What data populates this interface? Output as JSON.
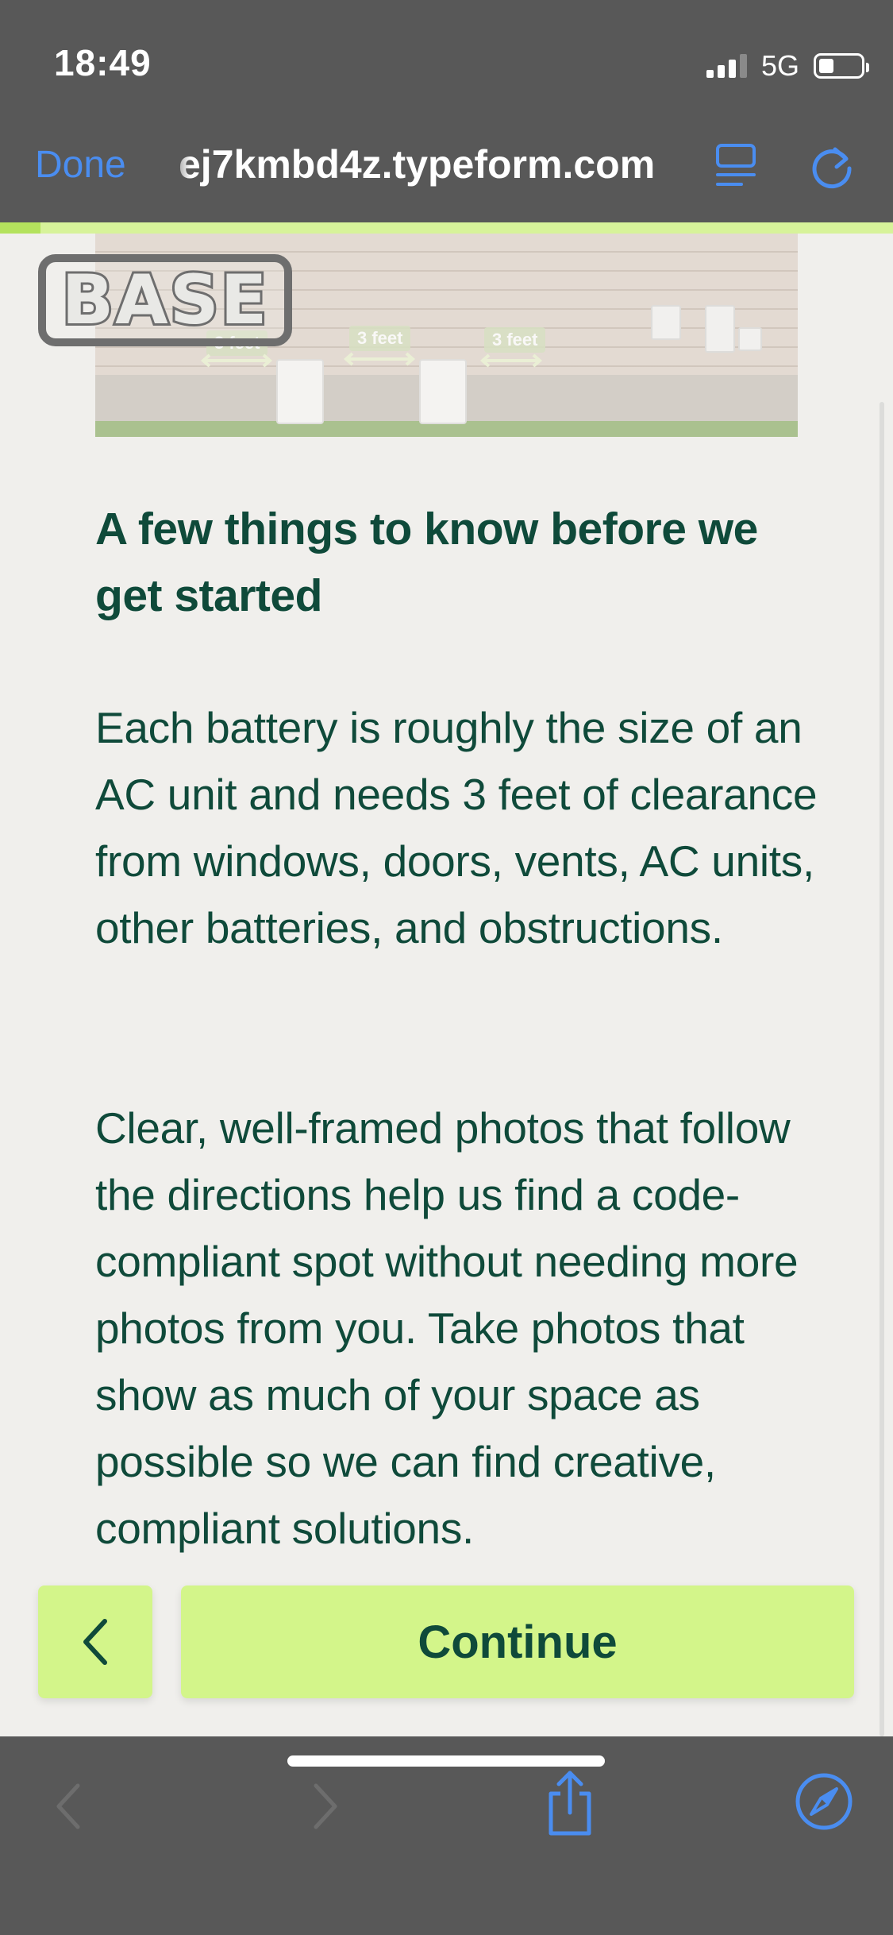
{
  "status_bar": {
    "time": "18:49",
    "network": "5G",
    "battery_level": 0.35
  },
  "browser": {
    "done_label": "Done",
    "url": "ej7kmbd4z.typeform.com",
    "accent_color": "#4a8df0"
  },
  "progress": {
    "fraction": 0.045
  },
  "hero": {
    "brand": "BASE",
    "clearance_labels": [
      "3 feet",
      "3 feet",
      "3 feet"
    ]
  },
  "content": {
    "heading": "A few things to know before we get started",
    "paragraph_1": "Each battery is roughly the size of an AC unit and needs 3 feet of clearance from windows, doors, vents, AC units, other batteries, and obstructions.",
    "paragraph_2": "Clear, well-framed photos that follow the directions help us find a code-compliant spot without needing more photos from you. Take photos that show as much of your space as possible so we can find creative, compliant solutions."
  },
  "actions": {
    "back_icon": "chevron-left-icon",
    "continue_label": "Continue",
    "button_color": "#d3f58a",
    "text_color": "#0f4a3a"
  },
  "toolbar": {
    "icons": [
      "back-arrow-icon",
      "forward-arrow-icon",
      "share-icon",
      "compass-icon"
    ]
  }
}
